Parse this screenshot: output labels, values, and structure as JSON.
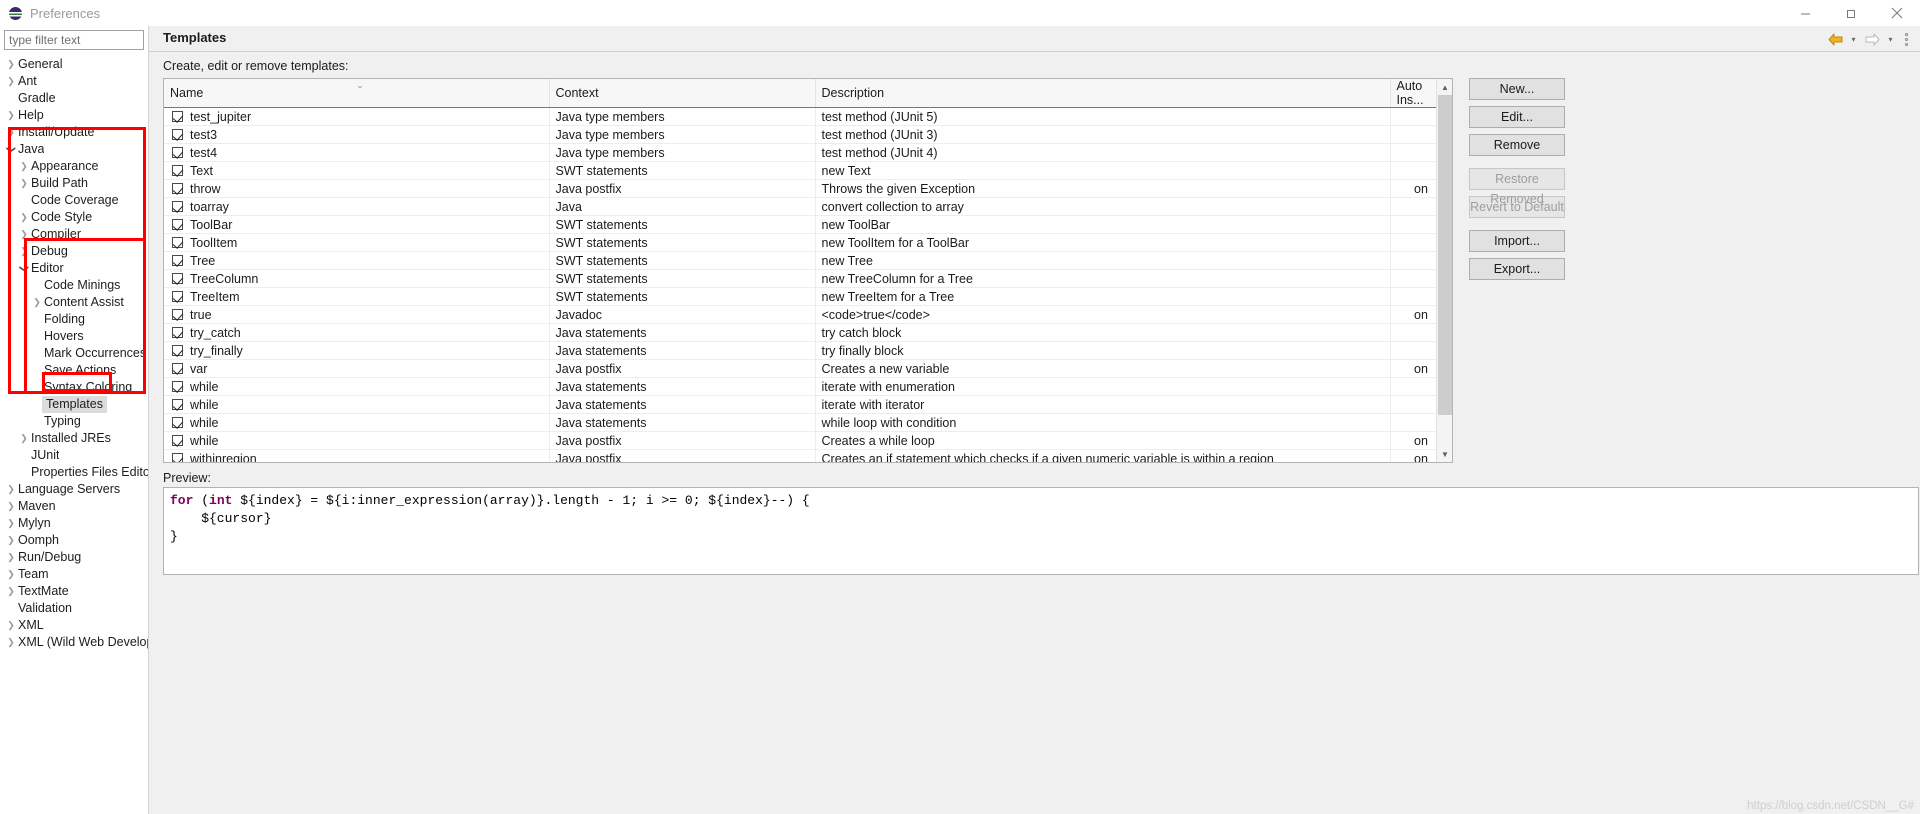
{
  "window": {
    "title": "Preferences",
    "logo_icon": "eclipse-logo",
    "minimize_icon": "minimize-icon",
    "maximize_icon": "restore-icon",
    "close_icon": "close-icon"
  },
  "sidebar": {
    "filter_placeholder": "type filter text",
    "filter_value": "",
    "items": [
      {
        "label": "General",
        "depth": 0,
        "arrow": "collapsed"
      },
      {
        "label": "Ant",
        "depth": 0,
        "arrow": "collapsed"
      },
      {
        "label": "Gradle",
        "depth": 0,
        "arrow": "none"
      },
      {
        "label": "Help",
        "depth": 0,
        "arrow": "collapsed"
      },
      {
        "label": "Install/Update",
        "depth": 0,
        "arrow": "collapsed"
      },
      {
        "label": "Java",
        "depth": 0,
        "arrow": "expanded"
      },
      {
        "label": "Appearance",
        "depth": 1,
        "arrow": "collapsed"
      },
      {
        "label": "Build Path",
        "depth": 1,
        "arrow": "collapsed"
      },
      {
        "label": "Code Coverage",
        "depth": 1,
        "arrow": "none"
      },
      {
        "label": "Code Style",
        "depth": 1,
        "arrow": "collapsed"
      },
      {
        "label": "Compiler",
        "depth": 1,
        "arrow": "collapsed"
      },
      {
        "label": "Debug",
        "depth": 1,
        "arrow": "collapsed"
      },
      {
        "label": "Editor",
        "depth": 1,
        "arrow": "expanded"
      },
      {
        "label": "Code Minings",
        "depth": 2,
        "arrow": "none"
      },
      {
        "label": "Content Assist",
        "depth": 2,
        "arrow": "collapsed"
      },
      {
        "label": "Folding",
        "depth": 2,
        "arrow": "none"
      },
      {
        "label": "Hovers",
        "depth": 2,
        "arrow": "none"
      },
      {
        "label": "Mark Occurrences",
        "depth": 2,
        "arrow": "none"
      },
      {
        "label": "Save Actions",
        "depth": 2,
        "arrow": "none"
      },
      {
        "label": "Syntax Coloring",
        "depth": 2,
        "arrow": "none"
      },
      {
        "label": "Templates",
        "depth": 2,
        "arrow": "none",
        "selected": true
      },
      {
        "label": "Typing",
        "depth": 2,
        "arrow": "none"
      },
      {
        "label": "Installed JREs",
        "depth": 1,
        "arrow": "collapsed"
      },
      {
        "label": "JUnit",
        "depth": 1,
        "arrow": "none"
      },
      {
        "label": "Properties Files Editor",
        "depth": 1,
        "arrow": "none"
      },
      {
        "label": "Language Servers",
        "depth": 0,
        "arrow": "collapsed"
      },
      {
        "label": "Maven",
        "depth": 0,
        "arrow": "collapsed"
      },
      {
        "label": "Mylyn",
        "depth": 0,
        "arrow": "collapsed"
      },
      {
        "label": "Oomph",
        "depth": 0,
        "arrow": "collapsed"
      },
      {
        "label": "Run/Debug",
        "depth": 0,
        "arrow": "collapsed"
      },
      {
        "label": "Team",
        "depth": 0,
        "arrow": "collapsed"
      },
      {
        "label": "TextMate",
        "depth": 0,
        "arrow": "collapsed"
      },
      {
        "label": "Validation",
        "depth": 0,
        "arrow": "none"
      },
      {
        "label": "XML",
        "depth": 0,
        "arrow": "collapsed"
      },
      {
        "label": "XML (Wild Web Develop",
        "depth": 0,
        "arrow": "collapsed"
      }
    ]
  },
  "header": {
    "page_title": "Templates",
    "back_icon": "back-arrow-icon",
    "back_caret_icon": "chevron-down-icon",
    "forward_icon": "forward-arrow-icon",
    "forward_caret_icon": "chevron-down-icon",
    "menu_icon": "view-menu-icon"
  },
  "main": {
    "section_label": "Create, edit or remove templates:",
    "columns": [
      "Name",
      "Context",
      "Description",
      "Auto Ins..."
    ],
    "sort_column": "Name",
    "sort_indicator": "chevron-down-icon",
    "rows": [
      {
        "checked": true,
        "name": "test_jupiter",
        "context": "Java type members",
        "description": "test method (JUnit 5)",
        "auto": ""
      },
      {
        "checked": true,
        "name": "test3",
        "context": "Java type members",
        "description": "test method (JUnit 3)",
        "auto": ""
      },
      {
        "checked": true,
        "name": "test4",
        "context": "Java type members",
        "description": "test method (JUnit 4)",
        "auto": ""
      },
      {
        "checked": true,
        "name": "Text",
        "context": "SWT statements",
        "description": "new Text",
        "auto": ""
      },
      {
        "checked": true,
        "name": "throw",
        "context": "Java postfix",
        "description": "Throws the given Exception",
        "auto": "on"
      },
      {
        "checked": true,
        "name": "toarray",
        "context": "Java",
        "description": "convert collection to array",
        "auto": ""
      },
      {
        "checked": true,
        "name": "ToolBar",
        "context": "SWT statements",
        "description": "new ToolBar",
        "auto": ""
      },
      {
        "checked": true,
        "name": "ToolItem",
        "context": "SWT statements",
        "description": "new ToolItem for a ToolBar",
        "auto": ""
      },
      {
        "checked": true,
        "name": "Tree",
        "context": "SWT statements",
        "description": "new Tree",
        "auto": ""
      },
      {
        "checked": true,
        "name": "TreeColumn",
        "context": "SWT statements",
        "description": "new TreeColumn for a Tree",
        "auto": ""
      },
      {
        "checked": true,
        "name": "TreeItem",
        "context": "SWT statements",
        "description": "new TreeItem for a Tree",
        "auto": ""
      },
      {
        "checked": true,
        "name": "true",
        "context": "Javadoc",
        "description": "<code>true</code>",
        "auto": "on"
      },
      {
        "checked": true,
        "name": "try_catch",
        "context": "Java statements",
        "description": "try catch block",
        "auto": ""
      },
      {
        "checked": true,
        "name": "try_finally",
        "context": "Java statements",
        "description": "try finally block",
        "auto": ""
      },
      {
        "checked": true,
        "name": "var",
        "context": "Java postfix",
        "description": "Creates a new variable",
        "auto": "on"
      },
      {
        "checked": true,
        "name": "while",
        "context": "Java statements",
        "description": "iterate with enumeration",
        "auto": ""
      },
      {
        "checked": true,
        "name": "while",
        "context": "Java statements",
        "description": "iterate with iterator",
        "auto": ""
      },
      {
        "checked": true,
        "name": "while",
        "context": "Java statements",
        "description": "while loop with condition",
        "auto": ""
      },
      {
        "checked": true,
        "name": "while",
        "context": "Java postfix",
        "description": "Creates a while loop",
        "auto": "on"
      },
      {
        "checked": true,
        "name": "withinregion",
        "context": "Java postfix",
        "description": "Creates an if statement which checks if a given numeric variable is within a region",
        "auto": "on"
      }
    ],
    "scroll_up_icon": "chevron-up-icon",
    "scroll_down_icon": "chevron-down-icon"
  },
  "buttons": [
    {
      "label": "New...",
      "enabled": true
    },
    {
      "label": "Edit...",
      "enabled": true
    },
    {
      "label": "Remove",
      "enabled": true
    },
    {
      "label": "Restore Removed",
      "enabled": false
    },
    {
      "label": "Revert to Default",
      "enabled": false
    },
    {
      "label": "Import...",
      "enabled": true
    },
    {
      "label": "Export...",
      "enabled": true
    }
  ],
  "preview": {
    "label": "Preview:",
    "line1_kw1": "for",
    "line1_a": " (",
    "line1_kw2": "int",
    "line1_b": " ${index} = ${i:inner_expression(array)}.length - 1; i >= 0; ${index}--) {",
    "line2": "    ${cursor}",
    "line3": "}"
  },
  "watermark": "https://blog.csdn.net/CSDN__G#",
  "colors": {
    "annotation_red": "#ff0000",
    "keyword_purple": "#7f0055",
    "selection_gray": "#dcdcdc",
    "button_face": "#e1e1e1"
  }
}
